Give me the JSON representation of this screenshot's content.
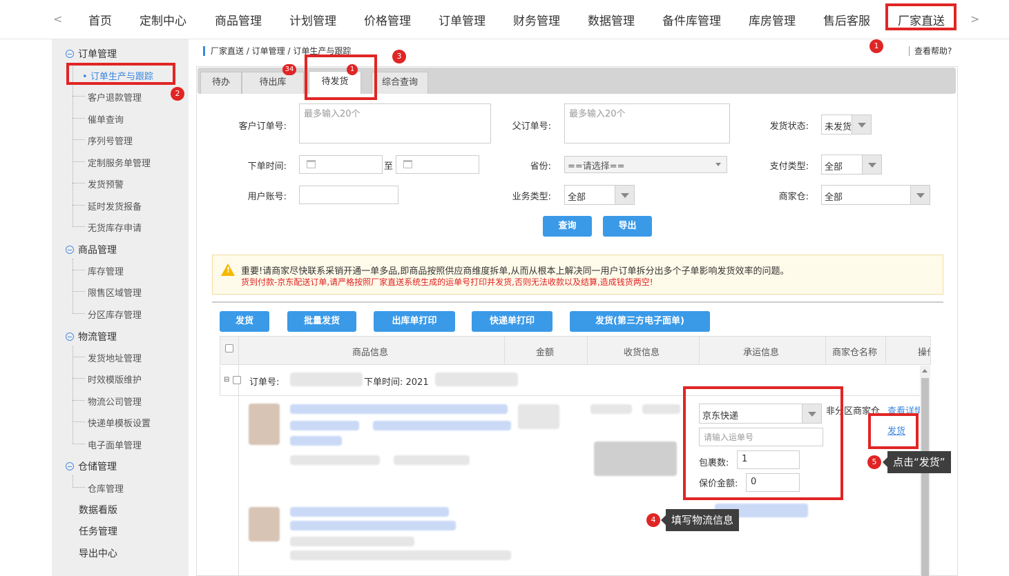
{
  "nav": {
    "prev": "<",
    "next": ">",
    "items": [
      "首页",
      "定制中心",
      "商品管理",
      "计划管理",
      "价格管理",
      "订单管理",
      "财务管理",
      "数据管理",
      "备件库管理",
      "库房管理",
      "售后客服",
      "厂家直送"
    ]
  },
  "sidebar": {
    "groups": [
      {
        "label": "订单管理",
        "items": [
          "订单生产与跟踪",
          "客户退款管理",
          "催单查询",
          "序列号管理",
          "定制服务单管理",
          "发货预警",
          "延时发货报备",
          "无货库存申请"
        ]
      },
      {
        "label": "商品管理",
        "items": [
          "库存管理",
          "限售区域管理",
          "分区库存管理"
        ]
      },
      {
        "label": "物流管理",
        "items": [
          "发货地址管理",
          "时效模版维护",
          "物流公司管理",
          "快递单模板设置",
          "电子面单管理"
        ]
      },
      {
        "label": "仓储管理",
        "items": [
          "仓库管理"
        ]
      }
    ],
    "plain": [
      "数据看版",
      "任务管理",
      "导出中心"
    ]
  },
  "breadcrumb": "厂家直送 / 订单管理 / 订单生产与跟踪",
  "help": "查看帮助?",
  "tabs": [
    {
      "label": "待办",
      "badge": ""
    },
    {
      "label": "待出库",
      "badge": "34"
    },
    {
      "label": "待发货",
      "badge": "1"
    },
    {
      "label": "综合查询",
      "badge": ""
    }
  ],
  "form": {
    "customer_order_label": "客户订单号:",
    "customer_order_placeholder": "最多输入20个",
    "parent_order_label": "父订单号:",
    "parent_order_placeholder": "最多输入20个",
    "ship_status_label": "发货状态:",
    "ship_status_value": "未发货",
    "order_time_label": "下单时间:",
    "to_label": "至",
    "province_label": "省份:",
    "province_value": "==请选择==",
    "pay_type_label": "支付类型:",
    "pay_type_value": "全部",
    "user_account_label": "用户账号:",
    "biz_type_label": "业务类型:",
    "biz_type_value": "全部",
    "warehouse_label": "商家仓:",
    "warehouse_value": "全部",
    "query_btn": "查询",
    "export_btn": "导出"
  },
  "notice": {
    "line1": "重要!请商家尽快联系采销开通一单多品,即商品按照供应商维度拆单,从而从根本上解决同一用户订单拆分出多个子单影响发货效率的问题。",
    "line2": "货到付款-京东配送订单,请严格按照厂家直送系统生成的运单号打印并发货,否则无法收款以及结算,造成钱货两空!"
  },
  "actions": [
    "发货",
    "批量发货",
    "出库单打印",
    "快递单打印",
    "发货(第三方电子面单)"
  ],
  "table": {
    "headers": [
      "商品信息",
      "金额",
      "收货信息",
      "承运信息",
      "商家仓名称",
      "操作"
    ],
    "order_no_label": "订单号:",
    "order_time_label": "下单时间: 2021",
    "carrier_value": "京东快递",
    "waybill_placeholder": "请输入运单号",
    "package_label": "包裹数:",
    "package_value": "1",
    "insured_label": "保价金额:",
    "insured_value": "0",
    "warehouse_name": "非分区商家仓",
    "view_detail": "查看详情",
    "ship_link": "发货"
  },
  "annotations": {
    "b1": "1",
    "b2": "2",
    "b3": "3",
    "b4": "4",
    "b5": "5",
    "tip4": "填写物流信息",
    "tip5": "点击“发货”"
  },
  "colors": {
    "accent": "#3a9ae8",
    "annotation": "#e02525",
    "warning": "#e02020"
  }
}
